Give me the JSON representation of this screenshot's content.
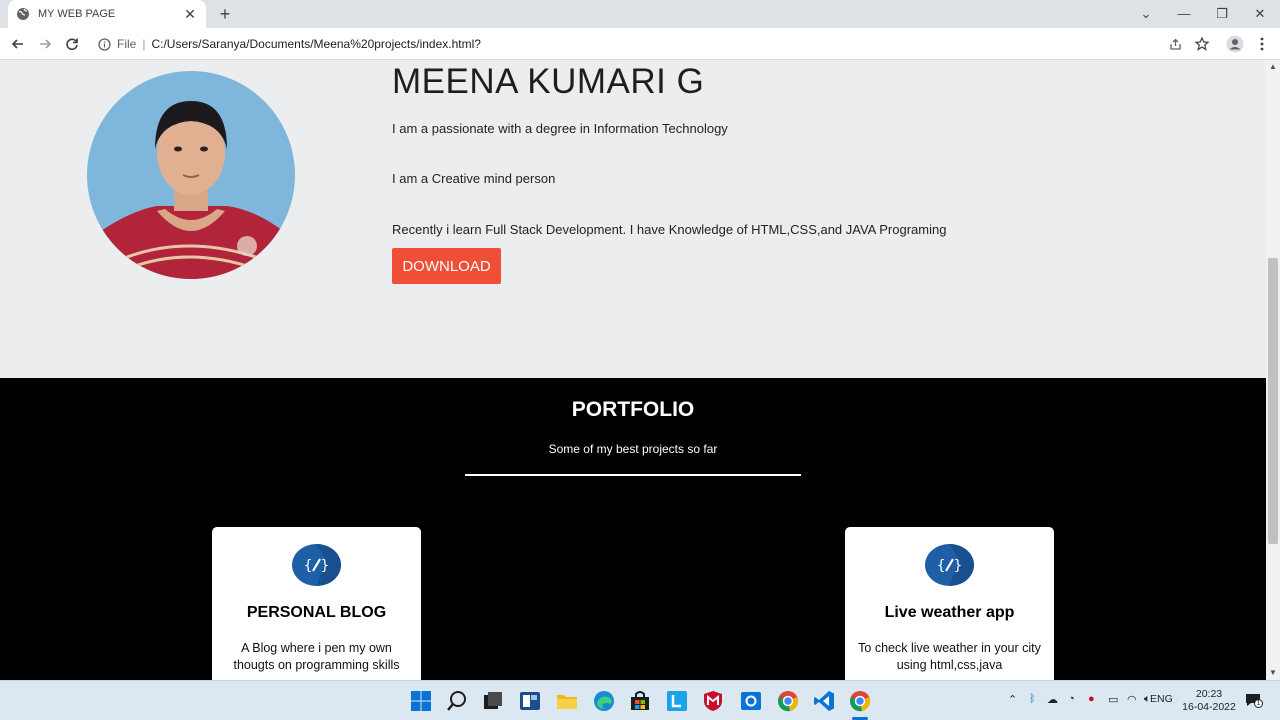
{
  "browser": {
    "tab_title": "MY WEB PAGE",
    "new_tab": "+",
    "address_label": "File",
    "url": "C:/Users/Saranya/Documents/Meena%20projects/index.html?"
  },
  "hero": {
    "name": "MEENA KUMARI G",
    "lines": [
      "I am a passionate with a degree in Information Technology",
      "I am a Creative mind person",
      "Recently i learn Full Stack Development. I have Knowledge of HTML,CSS,and JAVA Programing"
    ],
    "download_label": "DOWNLOAD"
  },
  "portfolio": {
    "title": "PORTFOLIO",
    "subtitle": "Some of my best projects so far",
    "cards": [
      {
        "title": "PERSONAL BLOG",
        "description": "A Blog where i pen my own thougts on programming skills",
        "icon": "code-edit-icon"
      },
      {
        "title": "Live weather app",
        "description": "To check live weather in your city using html,css,java",
        "icon": "code-edit-icon"
      }
    ]
  },
  "taskbar": {
    "language": "ENG",
    "time": "20:23",
    "date": "16-04-2022",
    "notification_count": "1"
  },
  "colors": {
    "accent": "#f04e37",
    "icon_blue": "#1f5fa8",
    "hero_bg": "#ecedef",
    "portfolio_bg": "#000000"
  }
}
